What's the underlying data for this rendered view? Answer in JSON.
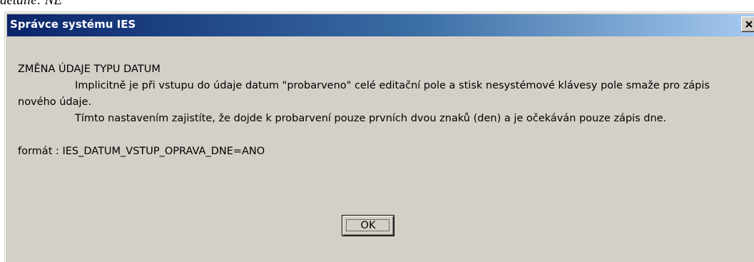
{
  "page": {
    "top_text": "detaile: NE"
  },
  "dialog": {
    "title": "Správce systému IES",
    "close_symbol": "×",
    "heading": "ZMĚNA ÚDAJE TYPU DATUM",
    "paragraph1": "Implicitně je při vstupu do údaje datum \"probarveno\" celé editační pole a stisk nesystémové klávesy pole smaže pro zápis nového údaje.",
    "paragraph2": "Tímto nastavením zajistíte, že dojde k probarvení pouze prvních dvou znaků (den) a je očekáván pouze zápis dne.",
    "format_line": "formát : IES_DATUM_VSTUP_OPRAVA_DNE=ANO",
    "ok_label": "OK"
  },
  "colors": {
    "title_gradient_start": "#0a246a",
    "title_gradient_end": "#a6caf0",
    "dialog_background": "#d4d0c8"
  },
  "icons": {
    "close": "close-icon"
  }
}
